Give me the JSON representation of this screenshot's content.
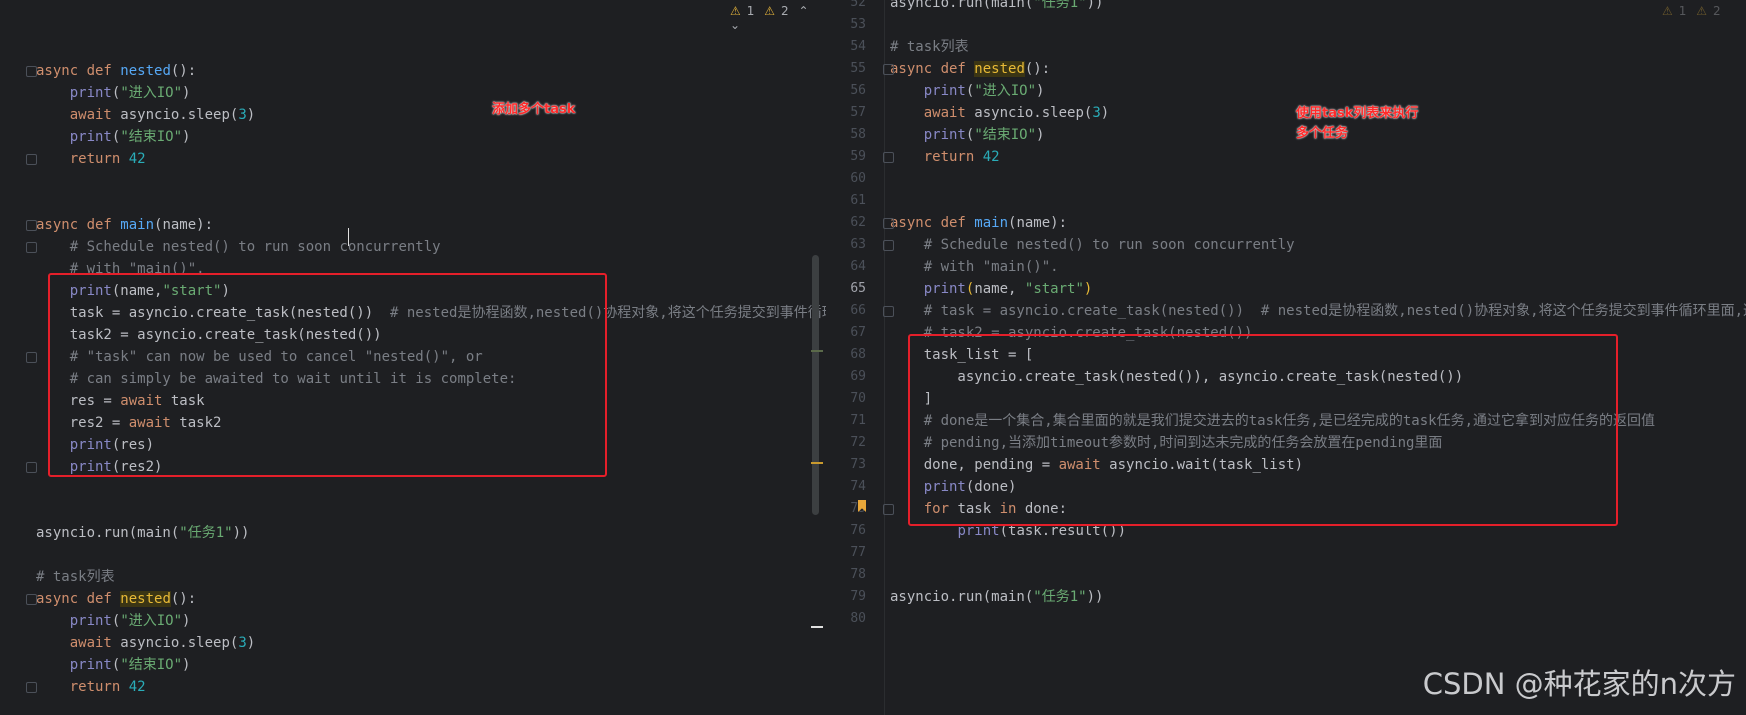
{
  "left": {
    "warnings": {
      "warn_count": "1",
      "weak_count": "2"
    },
    "annotation": "添加多个task",
    "lines": [
      {
        "html": ""
      },
      {
        "html": ""
      },
      {
        "html": "<span class=\"kw\">async def</span> <span class=\"fn\">nested</span>():"
      },
      {
        "html": "    <span class=\"bi\">print</span>(<span class=\"str\">\"进入IO\"</span>)"
      },
      {
        "html": "    <span class=\"kw\">await</span> asyncio.sleep(<span class=\"num\">3</span>)"
      },
      {
        "html": "    <span class=\"bi\">print</span>(<span class=\"str\">\"结束IO\"</span>)"
      },
      {
        "html": "    <span class=\"kw\">return</span> <span class=\"num\">42</span>"
      },
      {
        "html": ""
      },
      {
        "html": ""
      },
      {
        "html": "<span class=\"kw\">async def</span> <span class=\"fn\">main</span>(name):"
      },
      {
        "html": "    <span class=\"cm\"># Schedule nested() to run soon concurrently</span>"
      },
      {
        "html": "    <span class=\"cm\"># with \"main()\".</span>"
      },
      {
        "html": "    <span class=\"bi\">print</span>(name,<span class=\"str\">\"start\"</span>)"
      },
      {
        "html": "    task = asyncio.create_task(nested())  <span class=\"cm\"># nested是协程函数,nested()协程对象,将这个任务提交到事件循环里面,这个</span>"
      },
      {
        "html": "    task2 = asyncio.create_task(nested())"
      },
      {
        "html": "    <span class=\"cm\"># \"task\" can now be used to cancel \"nested()\", or</span>"
      },
      {
        "html": "    <span class=\"cm\"># can simply be awaited to wait until it is complete:</span>"
      },
      {
        "html": "    res = <span class=\"kw\">await</span> task"
      },
      {
        "html": "    res2 = <span class=\"kw\">await</span> task2"
      },
      {
        "html": "    <span class=\"bi\">print</span>(res)"
      },
      {
        "html": "    <span class=\"bi\">print</span>(res2)"
      },
      {
        "html": ""
      },
      {
        "html": ""
      },
      {
        "html": "asyncio.run(main(<span class=\"str\">\"任务1\"</span>))"
      },
      {
        "html": ""
      },
      {
        "html": "<span class=\"cm\"># task列表</span>"
      },
      {
        "html": "<span class=\"kw\">async def</span> <span class=\"hl-def\">nested</span>():"
      },
      {
        "html": "    <span class=\"bi\">print</span>(<span class=\"str\">\"进入IO\"</span>)"
      },
      {
        "html": "    <span class=\"kw\">await</span> asyncio.sleep(<span class=\"num\">3</span>)"
      },
      {
        "html": "    <span class=\"bi\">print</span>(<span class=\"str\">\"结束IO\"</span>)"
      },
      {
        "html": "    <span class=\"kw\">return</span> <span class=\"num\">42</span>"
      }
    ]
  },
  "right": {
    "warnings": {
      "warn_count": "1",
      "weak_count": "2"
    },
    "annotation_line1": "使用task列表来执行",
    "annotation_line2": "多个任务",
    "current_line": "65",
    "lines": [
      {
        "num": "52",
        "html": "asyncio.run(main(<span class=\"str\">\"任务1\"</span>))"
      },
      {
        "num": "53",
        "html": ""
      },
      {
        "num": "54",
        "html": "<span class=\"cm\"># task列表</span>"
      },
      {
        "num": "55",
        "html": "<span class=\"kw\">async def</span> <span class=\"hl-def\">nested</span>():"
      },
      {
        "num": "56",
        "html": "    <span class=\"bi\">print</span>(<span class=\"str\">\"进入IO\"</span>)"
      },
      {
        "num": "57",
        "html": "    <span class=\"kw\">await</span> asyncio.sleep(<span class=\"num\">3</span>)"
      },
      {
        "num": "58",
        "html": "    <span class=\"bi\">print</span>(<span class=\"str\">\"结束IO\"</span>)"
      },
      {
        "num": "59",
        "html": "    <span class=\"kw\">return</span> <span class=\"num\">42</span>"
      },
      {
        "num": "60",
        "html": ""
      },
      {
        "num": "61",
        "html": ""
      },
      {
        "num": "62",
        "html": "<span class=\"kw\">async def</span> <span class=\"fn\">main</span>(name):"
      },
      {
        "num": "63",
        "html": "    <span class=\"cm\"># Schedule nested() to run soon concurrently</span>"
      },
      {
        "num": "64",
        "html": "    <span class=\"cm\"># with \"main()\".</span>"
      },
      {
        "num": "65",
        "html": "    <span class=\"bi\">print</span><span style=\"color:#e8ba36\">(</span>name, <span class=\"str\">\"start\"</span><span style=\"color:#e8ba36\">)</span>"
      },
      {
        "num": "66",
        "html": "    <span class=\"cm\"># task = asyncio.create_task(nested())  # nested是协程函数,nested()协程对象,将这个任务提交到事件循环里面,这个task</span>"
      },
      {
        "num": "67",
        "html": "    <span class=\"cm\"># task2 = asyncio.create_task(nested())</span>"
      },
      {
        "num": "68",
        "html": "    task_list = ["
      },
      {
        "num": "69",
        "html": "        asyncio.create_task(nested()), asyncio.create_task(nested())"
      },
      {
        "num": "70",
        "html": "    ]"
      },
      {
        "num": "71",
        "html": "    <span class=\"cm\"># done是一个集合,集合里面的就是我们提交进去的task任务,是已经完成的task任务,通过它拿到对应任务的返回值</span>"
      },
      {
        "num": "72",
        "html": "    <span class=\"cm\"># pending,当添加timeout参数时,时间到达未完成的任务会放置在pending里面</span>"
      },
      {
        "num": "73",
        "html": "    done, pending = <span class=\"kw\">await</span> asyncio.wait(task_list)"
      },
      {
        "num": "74",
        "html": "    <span class=\"bi\">print</span>(done)"
      },
      {
        "num": "75",
        "html": "    <span class=\"kw\">for</span> task <span class=\"kw\">in</span> done:"
      },
      {
        "num": "76",
        "html": "        <span class=\"bi\">print</span>(task.result())"
      },
      {
        "num": "77",
        "html": ""
      },
      {
        "num": "78",
        "html": ""
      },
      {
        "num": "79",
        "html": "asyncio.run(main(<span class=\"str\">\"任务1\"</span>))"
      },
      {
        "num": "80",
        "html": ""
      }
    ]
  },
  "watermark": "CSDN @种花家的n次方"
}
